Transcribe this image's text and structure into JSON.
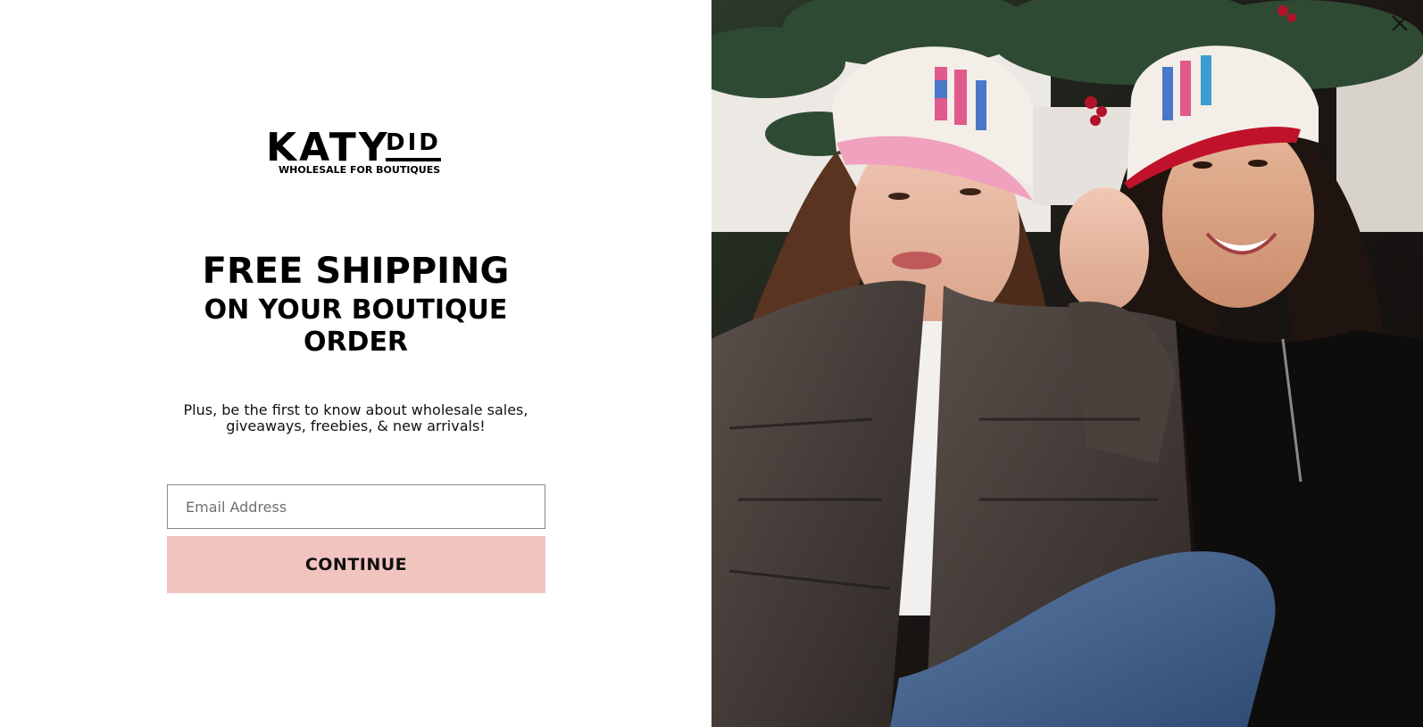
{
  "brand": {
    "logo_main": "KATY",
    "logo_did": "DID",
    "logo_sub": "WHOLESALE FOR BOUTIQUES"
  },
  "popup": {
    "headline_1": "FREE SHIPPING",
    "headline_2": "ON YOUR BOUTIQUE",
    "headline_3": "ORDER",
    "subtext": "Plus, be the first to know about wholesale sales, giveaways, freebies, & new arrivals!",
    "email_placeholder": "Email Address",
    "email_value": "",
    "continue_label": "CONTINUE",
    "accent_color": "#f2c4c0",
    "close_icon": "close-icon",
    "image_icon": "photo-two-women-in-holiday-caps"
  }
}
